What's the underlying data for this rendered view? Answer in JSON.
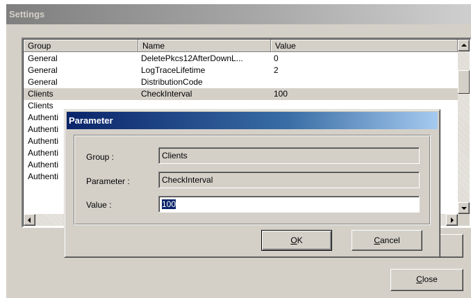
{
  "window": {
    "title": "Settings"
  },
  "list": {
    "columns": [
      "Group",
      "Name",
      "Value"
    ],
    "rows": [
      {
        "group": "General",
        "name": "DeletePkcs12AfterDownL...",
        "value": "0"
      },
      {
        "group": "General",
        "name": "LogTraceLifetime",
        "value": "2"
      },
      {
        "group": "General",
        "name": "DistributionCode",
        "value": ""
      },
      {
        "group": "Clients",
        "name": "CheckInterval",
        "value": "100"
      },
      {
        "group": "Clients",
        "name": "",
        "value": ""
      },
      {
        "group": "Authenti",
        "name": "",
        "value": ""
      },
      {
        "group": "Authenti",
        "name": "",
        "value": ""
      },
      {
        "group": "Authenti",
        "name": "",
        "value": ""
      },
      {
        "group": "Authenti",
        "name": "",
        "value": ""
      },
      {
        "group": "Authenti",
        "name": "",
        "value": ""
      },
      {
        "group": "Authenti",
        "name": "",
        "value": ""
      }
    ],
    "selected_index": 3
  },
  "close_button": {
    "mnemonic": "C",
    "rest": "lose"
  },
  "dialog": {
    "title": "Parameter",
    "group_label": "Group :",
    "group_value": "Clients",
    "parameter_label": "Parameter :",
    "parameter_value": "CheckInterval",
    "value_label": "Value :",
    "value_value": "100",
    "ok": {
      "mnemonic": "O",
      "rest": "K"
    },
    "cancel": {
      "mnemonic": "C",
      "rest": "ancel"
    }
  }
}
